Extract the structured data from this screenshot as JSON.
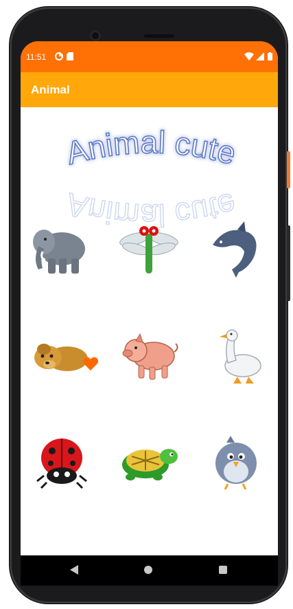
{
  "status_bar": {
    "time": "11:51",
    "icons": [
      "data-saver-icon",
      "sd-card-icon",
      "wifi-icon",
      "cell-signal-icon",
      "battery-icon"
    ]
  },
  "app_bar": {
    "title": "Animal"
  },
  "banner": {
    "text": "Animal cute"
  },
  "animals": [
    {
      "name": "elephant",
      "icon": "elephant-icon"
    },
    {
      "name": "dragonfly",
      "icon": "dragonfly-icon"
    },
    {
      "name": "dolphin",
      "icon": "dolphin-icon"
    },
    {
      "name": "dog",
      "icon": "dog-icon"
    },
    {
      "name": "pig",
      "icon": "pig-icon"
    },
    {
      "name": "goose",
      "icon": "goose-icon"
    },
    {
      "name": "ladybug",
      "icon": "ladybug-icon"
    },
    {
      "name": "turtle",
      "icon": "turtle-icon"
    },
    {
      "name": "bird",
      "icon": "bird-icon"
    }
  ],
  "favorite": {
    "icon": "heart-icon",
    "color": "#ff6a00"
  },
  "colors": {
    "status_bar": "#ff7005",
    "app_bar": "#ffa70b",
    "accent": "#ff6a00"
  },
  "nav_bar": {
    "icons": [
      "back-icon",
      "home-icon",
      "recents-icon"
    ]
  }
}
